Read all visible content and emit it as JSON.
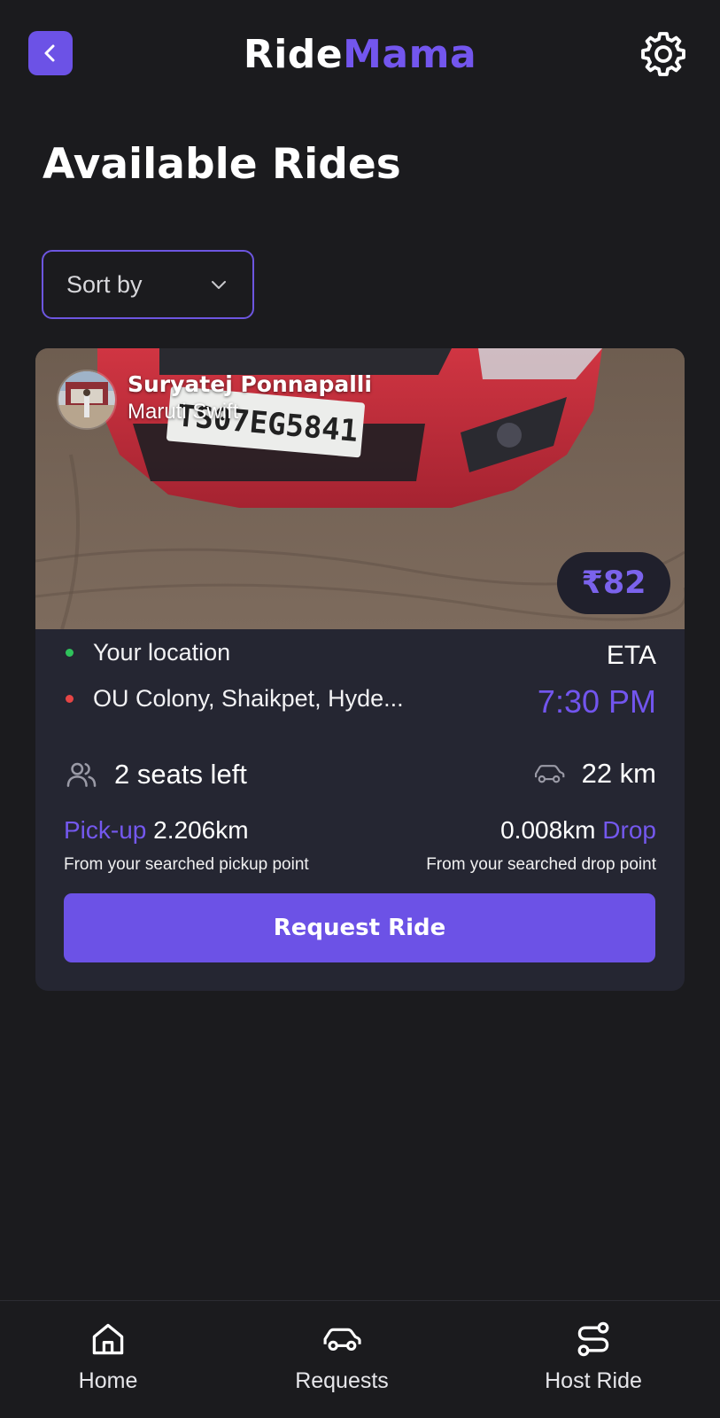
{
  "header": {
    "brand_part1": "Ride",
    "brand_part2": "Mama",
    "back_icon": "chevron-left-icon",
    "settings_icon": "gear-icon"
  },
  "page": {
    "title": "Available Rides"
  },
  "sort": {
    "label": "Sort by",
    "icon": "chevron-down-icon"
  },
  "ride": {
    "driver_name": "Suryatej Ponnapalli",
    "car_model": "Maruti Swift",
    "plate_text": "TS07EG5841",
    "price": "₹82",
    "origin": "Your location",
    "destination": "OU Colony, Shaikpet, Hyde...",
    "eta_label": "ETA",
    "eta_time": "7:30 PM",
    "seats": "2 seats left",
    "distance": "22 km",
    "pickup_label": "Pick-up",
    "pickup_distance": "2.206km",
    "pickup_sub": "From your searched pickup point",
    "drop_label": "Drop",
    "drop_distance": "0.008km",
    "drop_sub": "From your searched drop point",
    "request_label": "Request Ride"
  },
  "nav": {
    "items": [
      {
        "label": "Home",
        "icon": "home-icon"
      },
      {
        "label": "Requests",
        "icon": "car-icon"
      },
      {
        "label": "Host Ride",
        "icon": "route-icon"
      }
    ]
  },
  "colors": {
    "accent": "#6c52e6",
    "background": "#1b1b1e",
    "card": "#252632",
    "origin_dot": "#2fc25b",
    "destination_dot": "#e64545"
  }
}
